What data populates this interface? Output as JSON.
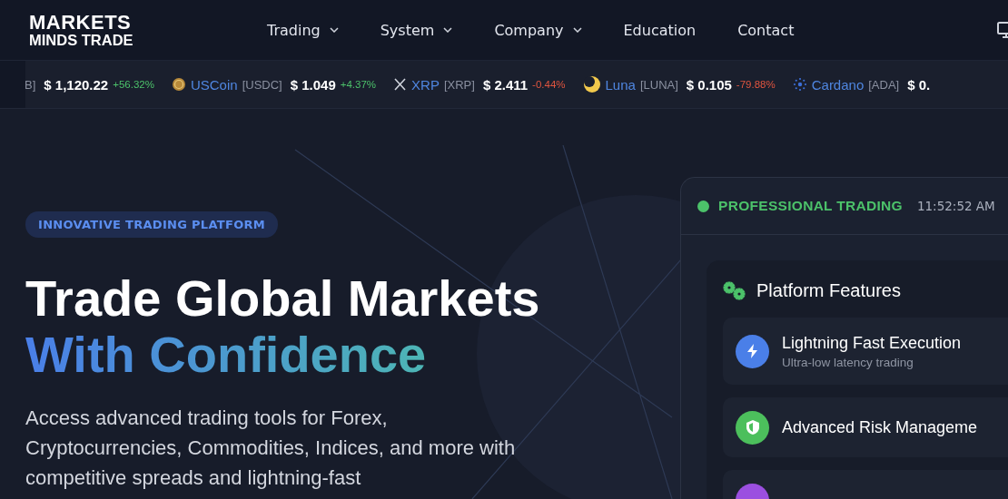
{
  "logo": {
    "line1": "MARKETS",
    "line2": "MINDS TRADE"
  },
  "nav": [
    {
      "label": "Trading",
      "dropdown": true
    },
    {
      "label": "System",
      "dropdown": true
    },
    {
      "label": "Company",
      "dropdown": true
    },
    {
      "label": "Education",
      "dropdown": false
    },
    {
      "label": "Contact",
      "dropdown": false
    }
  ],
  "ticker": [
    {
      "kind": "partial",
      "symbol": "B]",
      "price": "$ 1,120.22",
      "change": "+56.32%",
      "positive": true
    },
    {
      "kind": "full",
      "name": "USCoin",
      "symbol": "[USDC]",
      "price": "$ 1.049",
      "change": "+4.37%",
      "positive": true
    },
    {
      "kind": "full",
      "name": "XRP",
      "symbol": "[XRP]",
      "price": "$ 2.411",
      "change": "-0.44%",
      "positive": false
    },
    {
      "kind": "full",
      "name": "Luna",
      "symbol": "[LUNA]",
      "price": "$ 0.105",
      "change": "-79.88%",
      "positive": false
    },
    {
      "kind": "full",
      "name": "Cardano",
      "symbol": "[ADA]",
      "price": "$ 0."
    }
  ],
  "hero": {
    "badge": "INNOVATIVE TRADING PLATFORM",
    "title_line1": "Trade Global Markets",
    "title_line2": "With Confidence",
    "description": "Access advanced trading tools for Forex, Cryptocurrencies, Commodities, Indices, and more with competitive spreads and lightning-fast"
  },
  "panel": {
    "status": "PROFESSIONAL TRADING",
    "live": true,
    "time": "11:52:52 AM",
    "features_title": "Platform Features",
    "features": [
      {
        "title": "Lightning Fast Execution",
        "subtitle": "Ultra-low latency trading",
        "color": "#4a7fe8"
      },
      {
        "title": "Advanced Risk Manageme",
        "color": "#4cbf5c"
      },
      {
        "color": "#9b4fe0"
      }
    ]
  }
}
